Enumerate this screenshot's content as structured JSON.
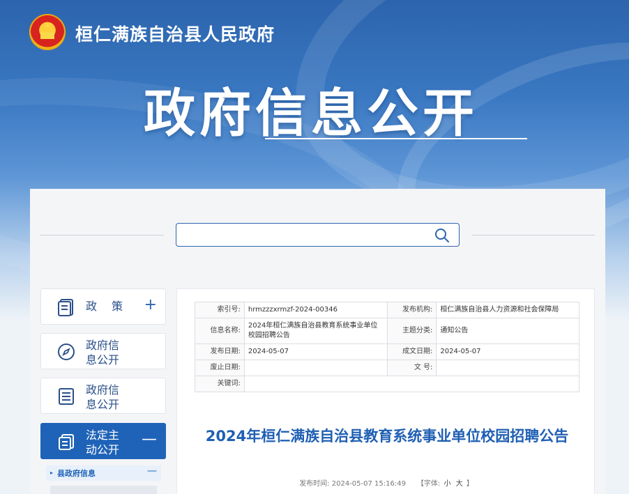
{
  "header": {
    "site_title": "桓仁满族自治县人民政府",
    "banner_title": "政府信息公开"
  },
  "search": {
    "value": "",
    "placeholder": ""
  },
  "sidebar": {
    "items": [
      {
        "label": "政 策",
        "icon": "document-icon",
        "toggle": "+"
      },
      {
        "label": "政府信息公开制度",
        "icon": "compass-icon",
        "toggle": ""
      },
      {
        "label": "政府信息公开指南",
        "icon": "list-icon",
        "toggle": ""
      },
      {
        "label": "法定主动公开内容",
        "icon": "copy-icon",
        "toggle": "—"
      }
    ],
    "sub_items": [
      {
        "label": "县政府信息",
        "toggle": "—"
      }
    ]
  },
  "meta_table": {
    "index_label": "索引号:",
    "index_value": "hrmzzzxrmzf-2024-00346",
    "org_label": "发布机构:",
    "org_value": "桓仁满族自治县人力资源和社会保障局",
    "name_label": "信息名称:",
    "name_value": "2024年桓仁满族自治县教育系统事业单位校园招聘公告",
    "topic_label": "主题分类:",
    "topic_value": "通知公告",
    "pub_date_label": "发布日期:",
    "pub_date_value": "2024-05-07",
    "created_label": "成文日期:",
    "created_value": "2024-05-07",
    "abolish_label": "废止日期:",
    "abolish_value": "",
    "docno_label": "文 号:",
    "docno_value": "",
    "keywords_label": "关键词:",
    "keywords_value": ""
  },
  "article": {
    "title": "2024年桓仁满族自治县教育系统事业单位校园招聘公告",
    "time_label": "发布时间:",
    "time_value": "2024-05-07 15:16:49",
    "font_label": "【字体:",
    "font_small": "小",
    "font_large": "大",
    "font_close": "】"
  },
  "colors": {
    "brand_blue": "#1f63b8",
    "title_blue": "#1f5fb3"
  }
}
